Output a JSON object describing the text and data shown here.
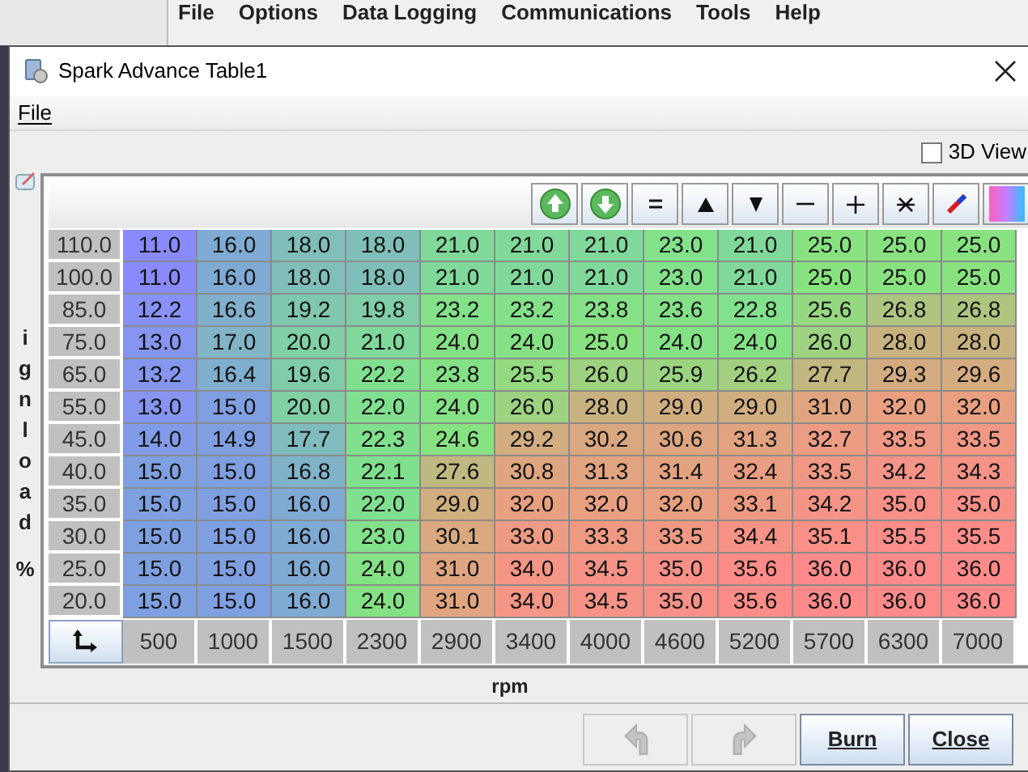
{
  "app_menu": [
    "File",
    "Options",
    "Data Logging",
    "Communications",
    "Tools",
    "Help"
  ],
  "window": {
    "title": "Spark Advance Table1"
  },
  "menu": [
    "File"
  ],
  "view_3d": {
    "label": "3D View",
    "checked": false
  },
  "y_axis": {
    "label": "ignload",
    "unit": "%"
  },
  "rows": [
    {
      "load": "110.0",
      "values": [
        "11.0",
        "16.0",
        "18.0",
        "18.0",
        "21.0",
        "21.0",
        "21.0",
        "23.0",
        "21.0",
        "25.0",
        "25.0",
        "25.0"
      ]
    },
    {
      "load": "100.0",
      "values": [
        "11.0",
        "16.0",
        "18.0",
        "18.0",
        "21.0",
        "21.0",
        "21.0",
        "23.0",
        "21.0",
        "25.0",
        "25.0",
        "25.0"
      ]
    },
    {
      "load": "85.0",
      "values": [
        "12.2",
        "16.6",
        "19.2",
        "19.8",
        "23.2",
        "23.2",
        "23.8",
        "23.6",
        "22.8",
        "25.6",
        "26.8",
        "26.8"
      ]
    },
    {
      "load": "75.0",
      "values": [
        "13.0",
        "17.0",
        "20.0",
        "21.0",
        "24.0",
        "24.0",
        "25.0",
        "24.0",
        "24.0",
        "26.0",
        "28.0",
        "28.0"
      ]
    },
    {
      "load": "65.0",
      "values": [
        "13.2",
        "16.4",
        "19.6",
        "22.2",
        "23.8",
        "25.5",
        "26.0",
        "25.9",
        "26.2",
        "27.7",
        "29.3",
        "29.6"
      ]
    },
    {
      "load": "55.0",
      "values": [
        "13.0",
        "15.0",
        "20.0",
        "22.0",
        "24.0",
        "26.0",
        "28.0",
        "29.0",
        "29.0",
        "31.0",
        "32.0",
        "32.0"
      ]
    },
    {
      "load": "45.0",
      "values": [
        "14.0",
        "14.9",
        "17.7",
        "22.3",
        "24.6",
        "29.2",
        "30.2",
        "30.6",
        "31.3",
        "32.7",
        "33.5",
        "33.5"
      ]
    },
    {
      "load": "40.0",
      "values": [
        "15.0",
        "15.0",
        "16.8",
        "22.1",
        "27.6",
        "30.8",
        "31.3",
        "31.4",
        "32.4",
        "33.5",
        "34.2",
        "34.3"
      ]
    },
    {
      "load": "35.0",
      "values": [
        "15.0",
        "15.0",
        "16.0",
        "22.0",
        "29.0",
        "32.0",
        "32.0",
        "32.0",
        "33.1",
        "34.2",
        "35.0",
        "35.0"
      ]
    },
    {
      "load": "30.0",
      "values": [
        "15.0",
        "15.0",
        "16.0",
        "23.0",
        "30.1",
        "33.0",
        "33.3",
        "33.5",
        "34.4",
        "35.1",
        "35.5",
        "35.5"
      ]
    },
    {
      "load": "25.0",
      "values": [
        "15.0",
        "15.0",
        "16.0",
        "24.0",
        "31.0",
        "34.0",
        "34.5",
        "35.0",
        "35.6",
        "36.0",
        "36.0",
        "36.0"
      ]
    },
    {
      "load": "20.0",
      "values": [
        "15.0",
        "15.0",
        "16.0",
        "24.0",
        "31.0",
        "34.0",
        "34.5",
        "35.0",
        "35.6",
        "36.0",
        "36.0",
        "36.0"
      ]
    }
  ],
  "rpm": [
    "500",
    "1000",
    "1500",
    "2300",
    "2900",
    "3400",
    "4000",
    "4600",
    "5200",
    "5700",
    "6300",
    "7000"
  ],
  "x_axis": {
    "label": "rpm"
  },
  "buttons": [
    {
      "kind": "undo",
      "disabled": true
    },
    {
      "kind": "redo",
      "disabled": true
    },
    {
      "kind": "text",
      "label": "Burn",
      "disabled": false
    },
    {
      "kind": "text",
      "label": "Close",
      "disabled": false
    }
  ]
}
